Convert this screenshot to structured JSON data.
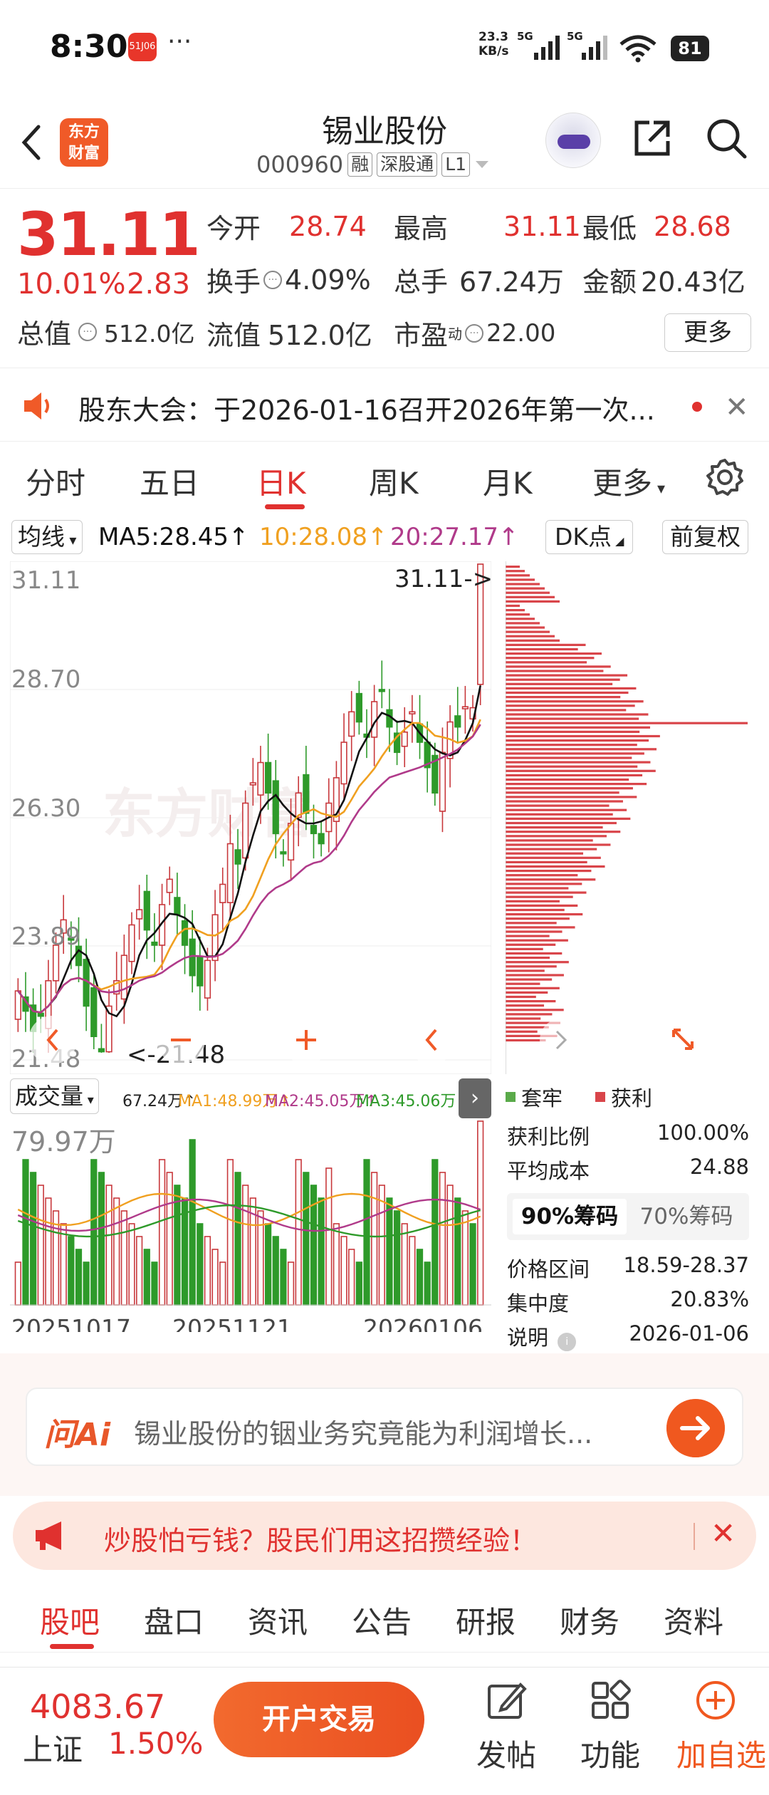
{
  "status_bar": {
    "time": "8:30",
    "app_badge": "51J06",
    "more": "···",
    "net_speed_value": "23.3",
    "net_speed_unit": "KB/s",
    "sig1": "5G",
    "sig2": "5G",
    "battery": "81"
  },
  "header": {
    "brand_line1": "东方",
    "brand_line2": "财富",
    "title": "锡业股份",
    "code": "000960",
    "tags": [
      "融",
      "深股通",
      "L1"
    ]
  },
  "quote": {
    "price": "31.11",
    "change_pct": "10.01%",
    "change": "2.83",
    "total_value_label": "总值",
    "total_value": "512.0亿",
    "items": [
      {
        "label": "今开",
        "value": "28.74"
      },
      {
        "label": "最高",
        "value": "31.11"
      },
      {
        "label": "最低",
        "value": "28.68"
      },
      {
        "label": "换手",
        "value": "4.09%"
      },
      {
        "label": "总手",
        "value": "67.24万"
      },
      {
        "label": "金额",
        "value": "20.43亿"
      },
      {
        "label": "流值",
        "value": "512.0亿"
      },
      {
        "label": "市盈",
        "sup": "动",
        "value": "22.00"
      }
    ],
    "more_label": "更多"
  },
  "notice": {
    "text": "股东大会：于2026-01-16召开2026年第一次..."
  },
  "chart_tabs": [
    "分时",
    "五日",
    "日K",
    "周K",
    "月K",
    "更多"
  ],
  "ma_row": {
    "select": "均线",
    "ma5": "MA5:28.45↑",
    "ma10": "10:28.08↑",
    "ma20": "20:27.17↑",
    "dk": "DK点",
    "fq": "前复权"
  },
  "kline": {
    "y_labels": [
      "31.11",
      "28.70",
      "26.30",
      "23.89",
      "21.48"
    ],
    "high_marker": "31.11->",
    "low_marker": "<-21.48",
    "watermark": "东方财富",
    "colors": {
      "up": "#c8383c",
      "down": "#2e9a2a",
      "ma5": "#111111",
      "ma10": "#f0a020",
      "ma20": "#b03a8a"
    }
  },
  "volume": {
    "select": "成交量",
    "vol": "67.24万↑",
    "ma1": "MA1:48.99万↑",
    "ma2": "MA2:45.05万↑",
    "ma3": "MA3:45.06万↑",
    "max_label": "79.97万",
    "dates": [
      "20251017",
      "20251121",
      "20260106"
    ]
  },
  "chips": {
    "legend_trapped": "套牢",
    "legend_profit": "获利",
    "profit_ratio_label": "获利比例",
    "profit_ratio": "100.00%",
    "avg_cost_label": "平均成本",
    "avg_cost": "24.88",
    "tab_90": "90%筹码",
    "tab_70": "70%筹码",
    "price_range_label": "价格区间",
    "price_range": "18.59-28.37",
    "concentration_label": "集中度",
    "concentration": "20.83%",
    "note_label": "说明",
    "note_date": "2026-01-06"
  },
  "ai": {
    "logo": "问Ai",
    "placeholder": "锡业股份的铟业务究竟能为利润增长..."
  },
  "promo": {
    "text": "炒股怕亏钱？股民们用这招攒经验！"
  },
  "sub_tabs": [
    "股吧",
    "盘口",
    "资讯",
    "公告",
    "研报",
    "财务",
    "资料"
  ],
  "footer": {
    "index_value": "4083.67",
    "index_name": "上证",
    "index_pct": "1.50%",
    "trade": "开户交易",
    "post": "发帖",
    "func": "功能",
    "add": "加自选"
  }
}
